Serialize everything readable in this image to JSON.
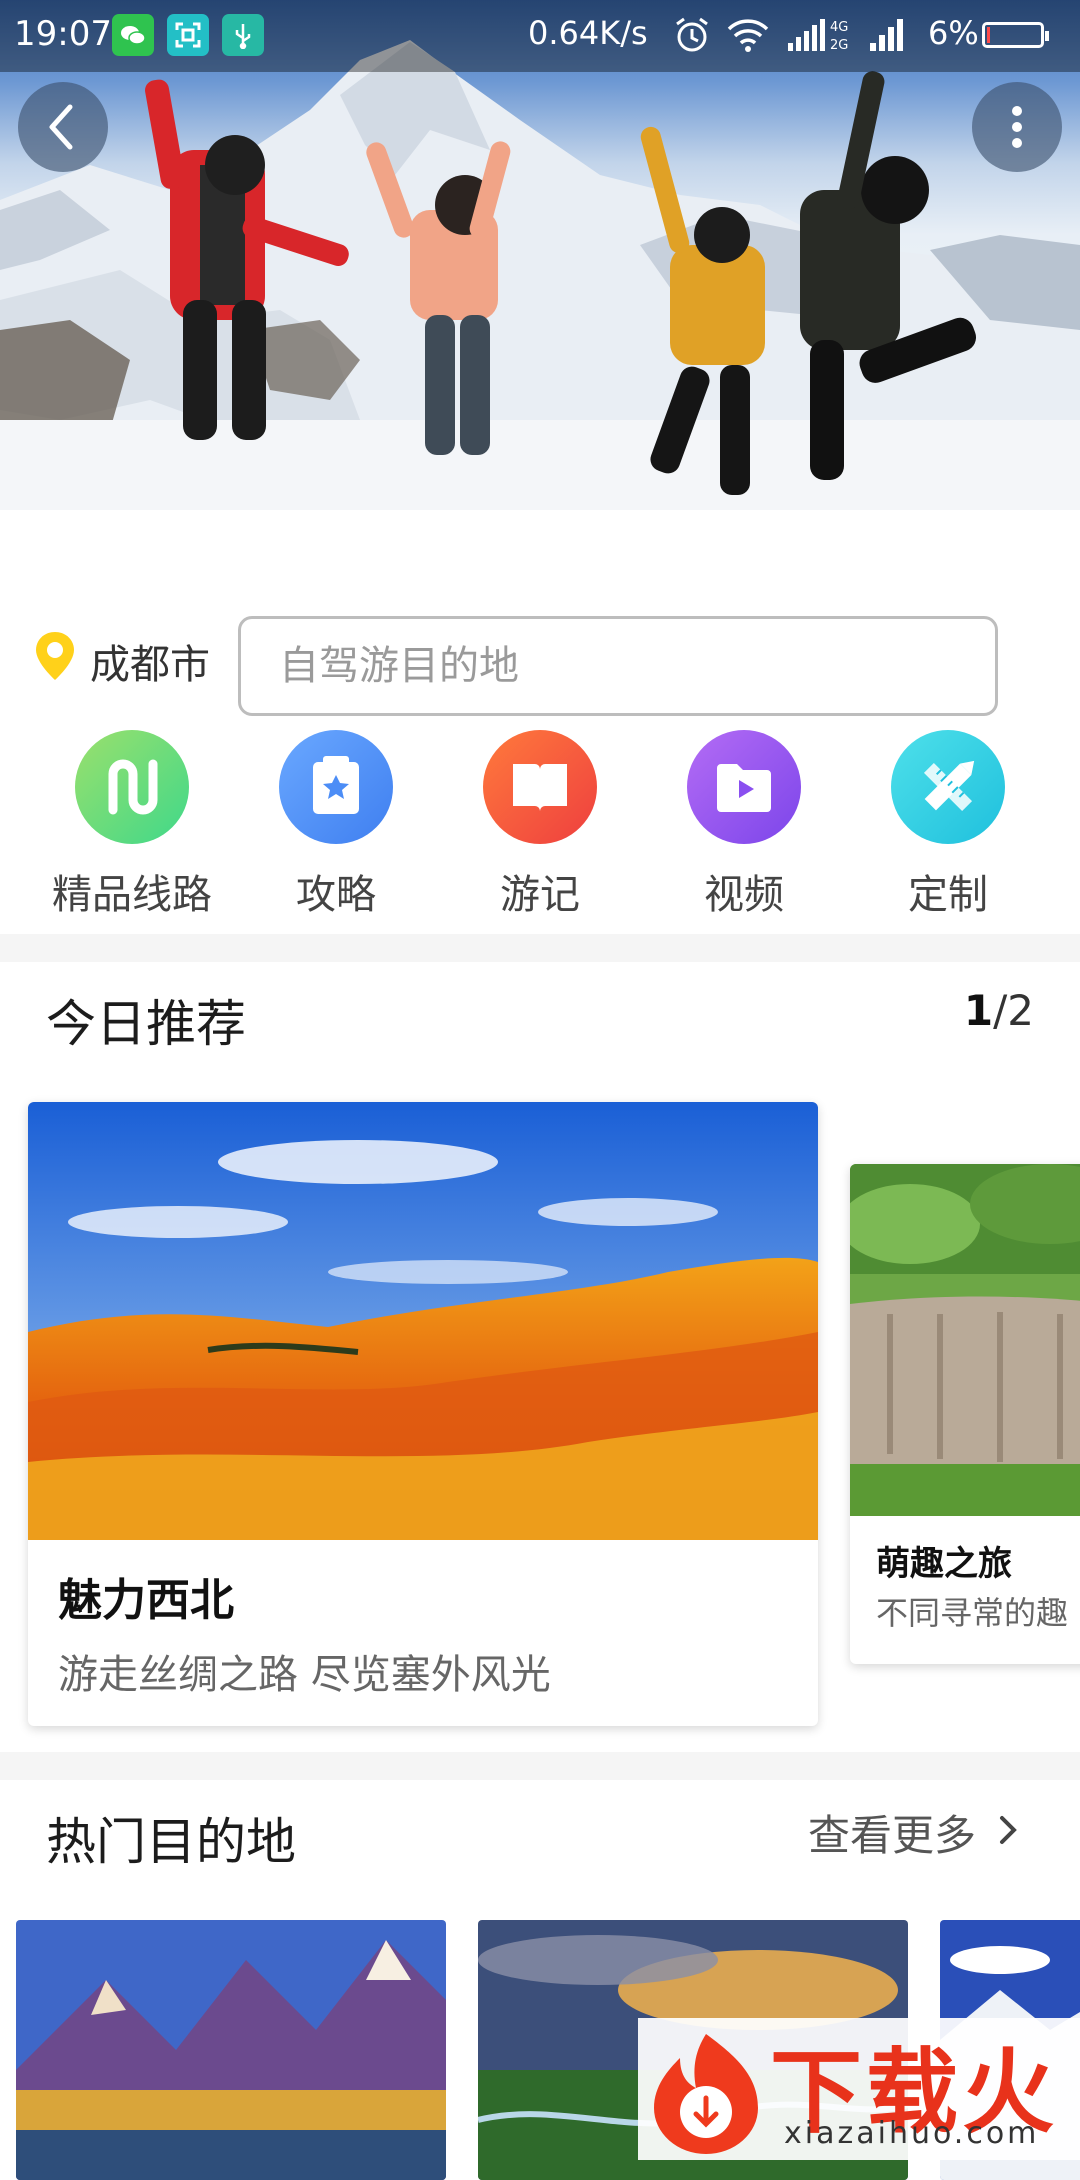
{
  "status_bar": {
    "time": "19:07",
    "net_speed": "0.64K/s",
    "battery_percent": "6%",
    "battery_level": 0.06,
    "icons": [
      "wechat-icon",
      "screenshot-icon",
      "usb-icon",
      "alarm-icon",
      "wifi-icon",
      "signal-4g-icon",
      "signal-icon",
      "battery-icon"
    ]
  },
  "hero": {
    "back_icon": "chevron-left-icon",
    "menu_icon": "more-vertical-icon"
  },
  "location": {
    "city": "成都市",
    "icon": "location-pin-icon",
    "icon_color": "#ffd11a"
  },
  "search": {
    "placeholder": "自驾游目的地",
    "value": ""
  },
  "categories": [
    {
      "label": "精品线路",
      "icon": "route-icon",
      "color": "#4cd87a"
    },
    {
      "label": "攻略",
      "icon": "guide-book-icon",
      "color": "#4c8df6"
    },
    {
      "label": "游记",
      "icon": "open-book-icon",
      "color": "#f2553a"
    },
    {
      "label": "视频",
      "icon": "video-folder-icon",
      "color": "#9b5cf0"
    },
    {
      "label": "定制",
      "icon": "pencil-ruler-icon",
      "color": "#2ed0e4"
    }
  ],
  "recommend": {
    "title": "今日推荐",
    "page_current": "1",
    "page_total": "/2",
    "cards": [
      {
        "title": "魅力西北",
        "subtitle": "游走丝绸之路 尽览塞外风光"
      },
      {
        "title": "萌趣之旅",
        "subtitle": "不同寻常的趣"
      }
    ]
  },
  "destinations": {
    "title": "热门目的地",
    "more_label": "查看更多"
  },
  "watermark": {
    "brand": "下载火",
    "url": "xiazaihuo.com"
  }
}
